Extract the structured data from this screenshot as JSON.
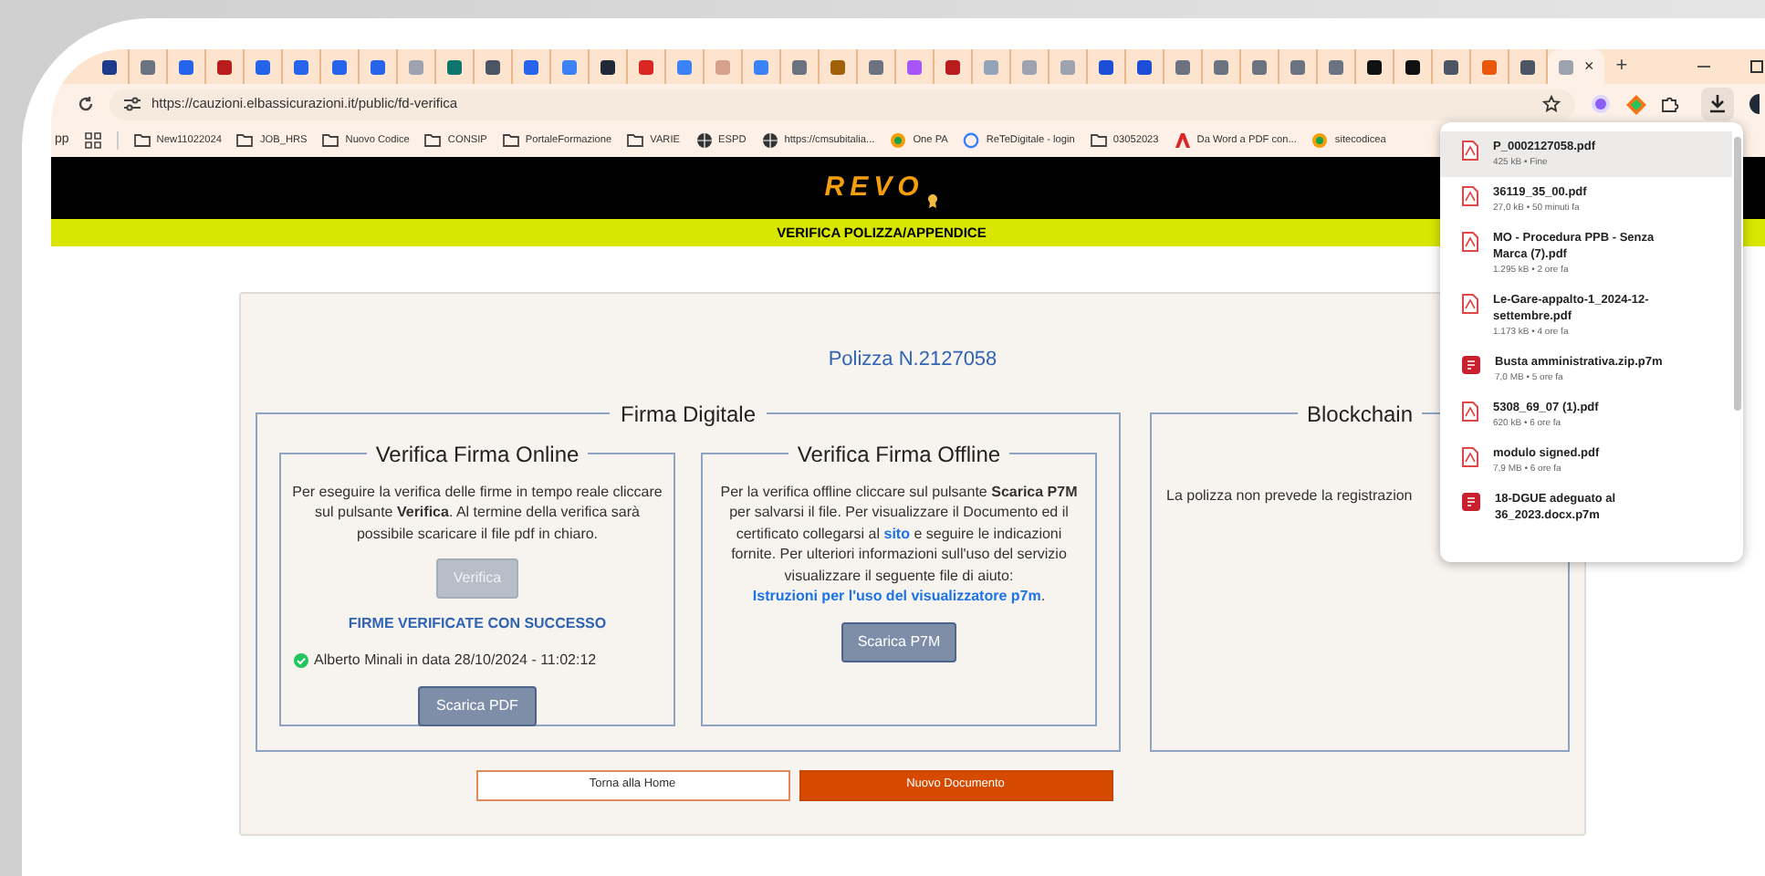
{
  "browser": {
    "tabs": [
      {
        "color": "#1e3a8a",
        "selected": false
      },
      {
        "color": "#6b7280",
        "selected": false
      },
      {
        "color": "#2563eb",
        "selected": false
      },
      {
        "color": "#b91c1c",
        "selected": false
      },
      {
        "color": "#2563eb",
        "selected": false
      },
      {
        "color": "#2563eb",
        "selected": false
      },
      {
        "color": "#2563eb",
        "selected": false
      },
      {
        "color": "#2563eb",
        "selected": false
      },
      {
        "color": "#9ca3af",
        "selected": false
      },
      {
        "color": "#0f766e",
        "selected": false
      },
      {
        "color": "#4b5563",
        "selected": false
      },
      {
        "color": "#2563eb",
        "selected": false
      },
      {
        "color": "#3b82f6",
        "selected": false
      },
      {
        "color": "#1f2937",
        "selected": false
      },
      {
        "color": "#dc2626",
        "selected": false
      },
      {
        "color": "#3b82f6",
        "selected": false
      },
      {
        "color": "#d6a08c",
        "selected": false
      },
      {
        "color": "#3b82f6",
        "selected": false
      },
      {
        "color": "#6b7280",
        "selected": false
      },
      {
        "color": "#a16207",
        "selected": false
      },
      {
        "color": "#6b7280",
        "selected": false
      },
      {
        "color": "#a855f7",
        "selected": false
      },
      {
        "color": "#b91c1c",
        "selected": false
      },
      {
        "color": "#93a3b8",
        "selected": false
      },
      {
        "color": "#9ca3af",
        "selected": false
      },
      {
        "color": "#9ca3af",
        "selected": false
      },
      {
        "color": "#1d4ed8",
        "selected": false
      },
      {
        "color": "#1d4ed8",
        "selected": false
      },
      {
        "color": "#6b7280",
        "selected": false
      },
      {
        "color": "#6b7280",
        "selected": false
      },
      {
        "color": "#6b7280",
        "selected": false
      },
      {
        "color": "#6b7280",
        "selected": false
      },
      {
        "color": "#6b7280",
        "selected": false
      },
      {
        "color": "#111111",
        "selected": false
      },
      {
        "color": "#111111",
        "selected": false
      },
      {
        "color": "#4b5563",
        "selected": false
      },
      {
        "color": "#ea580c",
        "selected": false
      },
      {
        "color": "#4b5563",
        "selected": false
      },
      {
        "color": "#9ca3af",
        "selected": true
      }
    ],
    "close_tab": "×",
    "new_tab": "+",
    "address": "https://cauzioni.elbassicurazioni.it/public/fd-verifica",
    "bookmarks": [
      {
        "kind": "text",
        "label": "pp"
      },
      {
        "kind": "grid"
      },
      {
        "kind": "folder",
        "label": "New11022024"
      },
      {
        "kind": "folder",
        "label": "JOB_HRS"
      },
      {
        "kind": "folder",
        "label": "Nuovo Codice"
      },
      {
        "kind": "folder",
        "label": "CONSIP"
      },
      {
        "kind": "folder",
        "label": "PortaleFormazione"
      },
      {
        "kind": "folder",
        "label": "VARIE"
      },
      {
        "kind": "globe",
        "label": "ESPD"
      },
      {
        "kind": "globe",
        "label": "https://cmsubitalia..."
      },
      {
        "kind": "site",
        "label": "One PA"
      },
      {
        "kind": "ring",
        "label": "ReTeDigitale - login"
      },
      {
        "kind": "folder",
        "label": "03052023"
      },
      {
        "kind": "pdf",
        "label": "Da Word a PDF con..."
      },
      {
        "kind": "site",
        "label": "sitecodicea"
      }
    ]
  },
  "downloads": {
    "items": [
      {
        "kind": "pdf",
        "name": "P_0002127058.pdf",
        "meta": "425 kB • Fine",
        "selected": true
      },
      {
        "kind": "pdf",
        "name": "36119_35_00.pdf",
        "meta": "27,0 kB • 50 minuti fa",
        "selected": false
      },
      {
        "kind": "pdf",
        "name": "MO - Procedura PPB - Senza Marca (7).pdf",
        "meta": "1.295 kB • 2 ore fa",
        "selected": false
      },
      {
        "kind": "pdf",
        "name": "Le-Gare-appalto-1_2024-12-settembre.pdf",
        "meta": "1.173 kB • 4 ore fa",
        "selected": false
      },
      {
        "kind": "p7m",
        "name": "Busta amministrativa.zip.p7m",
        "meta": "7,0 MB • 5 ore fa",
        "selected": false
      },
      {
        "kind": "pdf",
        "name": "5308_69_07 (1).pdf",
        "meta": "620 kB • 6 ore fa",
        "selected": false
      },
      {
        "kind": "pdf",
        "name": "modulo signed.pdf",
        "meta": "7,9 MB • 6 ore fa",
        "selected": false
      },
      {
        "kind": "p7m",
        "name": "18-DGUE adeguato al 36_2023.docx.p7m",
        "selected": false
      }
    ]
  },
  "page": {
    "logo": "REVO",
    "banner": "VERIFICA POLIZZA/APPENDICE",
    "policy": "Polizza N.2127058",
    "firma": {
      "title": "Firma Digitale",
      "online": {
        "title": "Verifica Firma Online",
        "text": "Per eseguire la verifica delle firme in tempo reale cliccare sul pulsante **Verifica**. Al termine della verifica sarà possibile scaricare il file pdf in chiaro.",
        "verify_button": {
          "label": "Verifica",
          "disabled": true
        },
        "status": "FIRME VERIFICATE CON SUCCESSO",
        "signer": "Alberto Minali in data 28/10/2024 - 11:02:12",
        "download_button": "Scarica PDF"
      },
      "offline": {
        "title": "Verifica Firma Offline",
        "segments": [
          {
            "kind": "text",
            "text": "Per la verifica offline cliccare sul pulsante **Scarica P7M** per salvarsi il file. Per visualizzare il Documento ed il certificato collegarsi al "
          },
          {
            "kind": "link",
            "text": "sito"
          },
          {
            "kind": "text",
            "text": " e seguire le indicazioni fornite. Per ulteriori informazioni sull'uso del servizio visualizzare il seguente file di aiuto: "
          },
          {
            "kind": "link",
            "text": "Istruzioni per l'uso del visualizzatore p7m"
          },
          {
            "kind": "text",
            "text": "."
          }
        ],
        "download_button": "Scarica P7M"
      }
    },
    "blockchain": {
      "title": "Blockchain",
      "text": "La polizza non prevede la registrazion"
    },
    "buttons": [
      {
        "kind": "outline",
        "label": "Torna alla Home"
      },
      {
        "kind": "primary",
        "label": "Nuovo Documento"
      }
    ]
  }
}
